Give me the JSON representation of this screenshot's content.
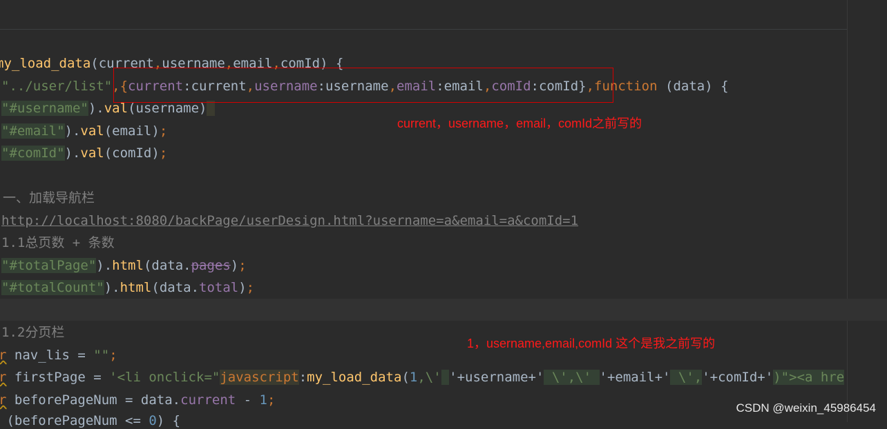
{
  "code_lines": {
    "l1": {
      "a": "my_load_data",
      "b": "(current",
      "c": ",",
      "d": "username",
      "e": ",",
      "f": "email",
      "g": ",",
      "h": "comId) {"
    },
    "l2": {
      "a": "\"../user/list\"",
      "b": ",{",
      "c": "current",
      "d": ":current",
      "e": ",",
      "f": "username",
      "g": ":username",
      "h": ",",
      "i": "email",
      "j": ":email",
      "k": ",",
      "l": "comId",
      "m": ":comId}",
      "n": ",",
      "o": "function",
      "p": " (data) {"
    },
    "l3": {
      "a": "\"#username\"",
      "b": ").",
      "c": "val",
      "d": "(username)"
    },
    "l4": {
      "a": "\"#email\"",
      "b": ").",
      "c": "val",
      "d": "(email)",
      "e": ";"
    },
    "l5": {
      "a": "\"#comId\"",
      "b": ").",
      "c": "val",
      "d": "(comId)",
      "e": ";"
    },
    "l6": {
      "a": "一、加载导航栏"
    },
    "l7": {
      "a": "http://localhost:8080/backPage/userDesign.html?username=a&email=a&comId=1"
    },
    "l8": {
      "a": "1.1总页数 + 条数"
    },
    "l9": {
      "a": "\"#totalPage\"",
      "b": ").",
      "c": "html",
      "d": "(data.",
      "e": "pages",
      "f": ")",
      "g": ";"
    },
    "l10": {
      "a": "\"#totalCount\"",
      "b": ").",
      "c": "html",
      "d": "(data.",
      "e": "total",
      "f": ")",
      "g": ";"
    },
    "l11": {
      "a": "1.2分页栏"
    },
    "l12": {
      "a": "r",
      "b": " nav_lis = ",
      "c": "\"\"",
      "d": ";"
    },
    "l13": {
      "a": "r",
      "b": " firstPage = ",
      "c": "'<li onclick=\"",
      "d": "javascript",
      "e": ":",
      "f": "my_load_data",
      "g": "(",
      "h": "1",
      "i": ",\\'",
      "j": " ",
      "k": "'+username+'",
      "l": " \\',\\'",
      "m": " ",
      "n": "'+email+'",
      "o": " \\',",
      "p": "'+comId+'",
      "q": ")\"><a hre"
    },
    "l14": {
      "a": "r",
      "b": " beforePageNum = data.",
      "c": "current",
      "d": " - ",
      "e": "1",
      "f": ";"
    },
    "l15": {
      "a": " (beforePageNum <= ",
      "b": "0",
      "c": ") {"
    }
  },
  "annotations": {
    "note1": "current，username，email，comId之前写的",
    "note2": "1，username,email,comId 这个是我之前写的"
  },
  "watermark": "CSDN @weixin_45986454",
  "colors": {
    "background": "#2b2b2b",
    "function": "#ffc66d",
    "string": "#6a8759",
    "keyword": "#cc7832",
    "property": "#9876aa",
    "number": "#6897bb",
    "comment": "#808080",
    "annotation": "#ff1a1a"
  }
}
